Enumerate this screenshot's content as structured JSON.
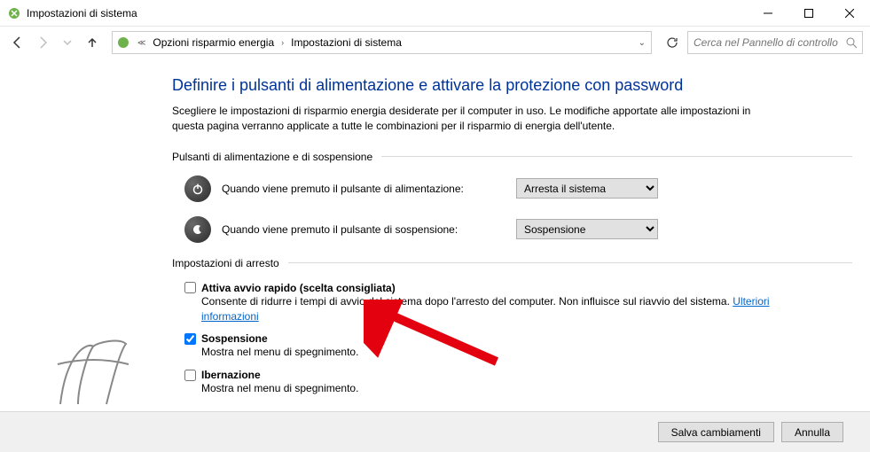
{
  "title": "Impostazioni di sistema",
  "breadcrumb": {
    "item1": "Opzioni risparmio energia",
    "item2": "Impostazioni di sistema"
  },
  "search": {
    "placeholder": "Cerca nel Pannello di controllo"
  },
  "page": {
    "heading": "Definire i pulsanti di alimentazione e attivare la protezione con password",
    "intro": "Scegliere le impostazioni di risparmio energia desiderate per il computer in uso. Le modifiche apportate alle impostazioni in questa pagina verranno applicate a tutte le combinazioni per il risparmio di energia dell'utente."
  },
  "group1": {
    "title": "Pulsanti di alimentazione e di sospensione",
    "rows": [
      {
        "label": "Quando viene premuto il pulsante di alimentazione:",
        "value": "Arresta il sistema"
      },
      {
        "label": "Quando viene premuto il pulsante di sospensione:",
        "value": "Sospensione"
      }
    ]
  },
  "group2": {
    "title": "Impostazioni di arresto",
    "items": [
      {
        "label": "Attiva avvio rapido (scelta consigliata)",
        "checked": false,
        "desc_pre": "Consente di ridurre i tempi di avvio del sistema dopo l'arresto del computer. Non influisce sul riavvio del sistema. ",
        "link": "Ulteriori informazioni"
      },
      {
        "label": "Sospensione",
        "checked": true,
        "desc": "Mostra nel menu di spegnimento."
      },
      {
        "label": "Ibernazione",
        "checked": false,
        "desc": "Mostra nel menu di spegnimento."
      }
    ]
  },
  "footer": {
    "save": "Salva cambiamenti",
    "cancel": "Annulla"
  }
}
